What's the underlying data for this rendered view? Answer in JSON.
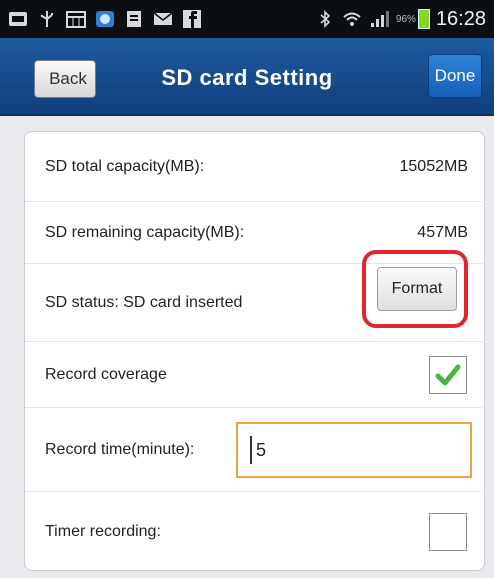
{
  "status_bar": {
    "icons": [
      "notification-icon",
      "usb-icon",
      "calendar-icon",
      "app-icon",
      "document-icon",
      "email-icon",
      "facebook-icon",
      "bluetooth-icon",
      "wifi-icon",
      "signal-icon"
    ],
    "battery": "96%",
    "time": "16:28"
  },
  "title_bar": {
    "back_label": "Back",
    "title": "SD card Setting",
    "done_label": "Done"
  },
  "settings": {
    "total_capacity_label": "SD total capacity(MB):",
    "total_capacity_value": "15052MB",
    "remaining_capacity_label": "SD remaining capacity(MB):",
    "remaining_capacity_value": "457MB",
    "status_label": "SD status: SD card inserted",
    "format_label": "Format",
    "record_coverage_label": "Record coverage",
    "record_coverage_checked": true,
    "record_time_label": "Record time(minute):",
    "record_time_value": "5",
    "timer_recording_label": "Timer recording:",
    "timer_recording_checked": false
  },
  "colors": {
    "title_bar": "#1a4f92",
    "highlight": "#e1262b",
    "input_focus": "#f0a33c",
    "check": "#4bb543"
  }
}
